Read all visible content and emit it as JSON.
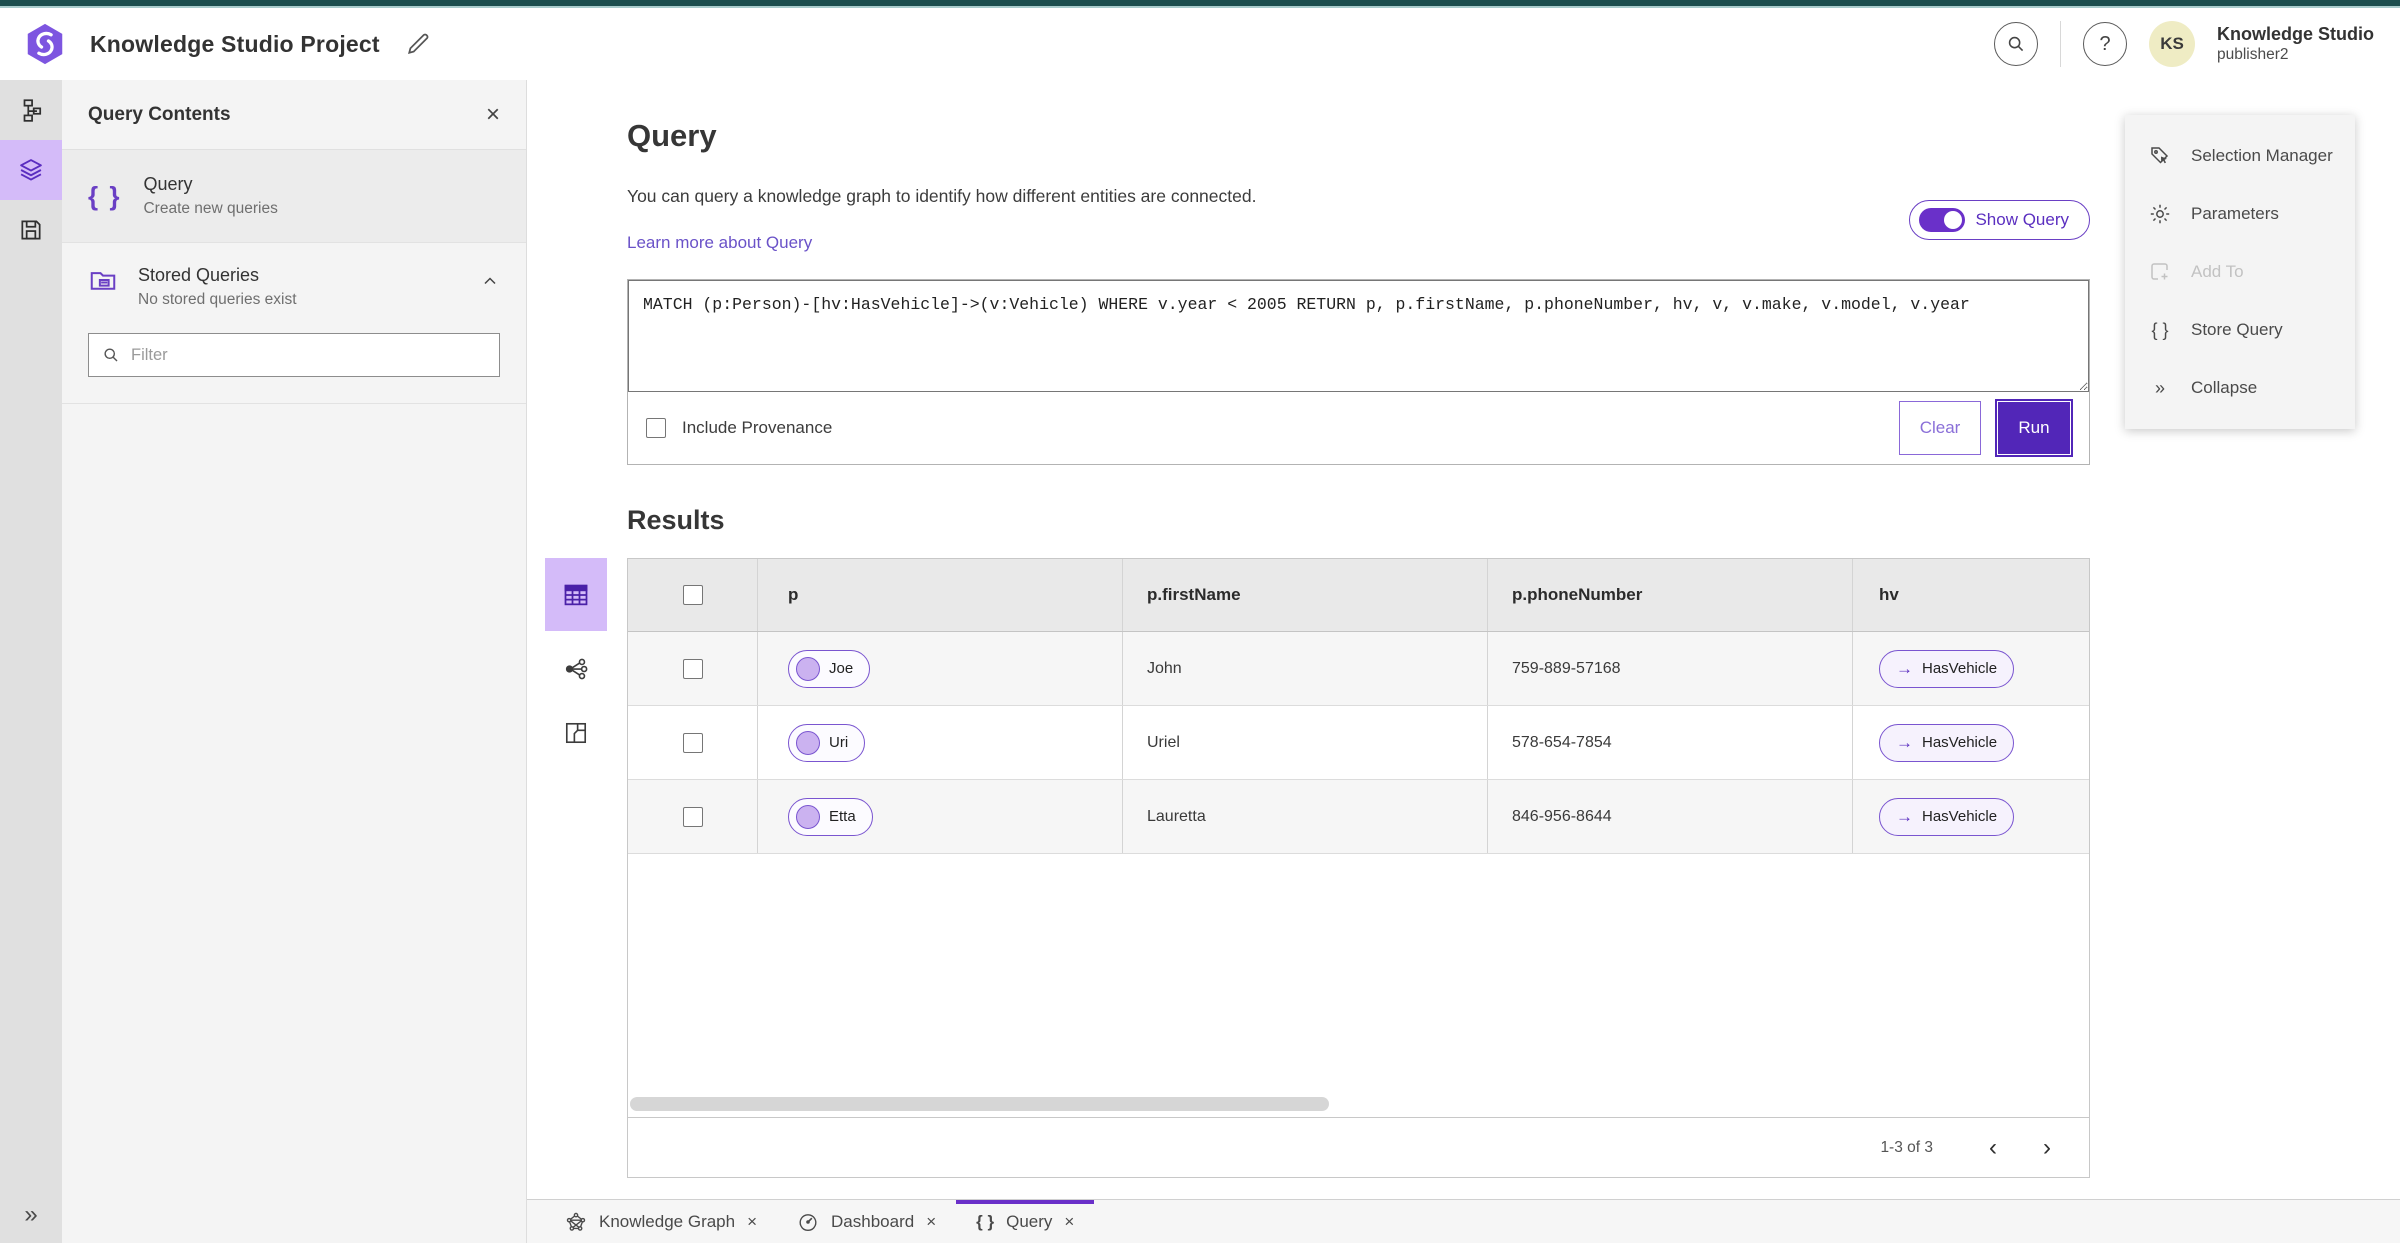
{
  "header": {
    "app_title": "Knowledge Studio Project",
    "user_name": "Knowledge Studio",
    "user_role": "publisher2",
    "avatar_initials": "KS"
  },
  "query_contents": {
    "title": "Query Contents",
    "query_item": {
      "label": "Query",
      "description": "Create new queries"
    },
    "stored_item": {
      "label": "Stored Queries",
      "description": "No stored queries exist"
    },
    "filter_placeholder": "Filter"
  },
  "query_panel": {
    "title": "Query",
    "description": "You can query a knowledge graph to identify how different entities are connected.",
    "link_label": "Learn more about Query",
    "show_query_label": "Show Query",
    "query_text": "MATCH (p:Person)-[hv:HasVehicle]->(v:Vehicle) WHERE v.year < 2005 RETURN p, p.firstName, p.phoneNumber, hv, v, v.make, v.model, v.year",
    "include_provenance_label": "Include Provenance",
    "clear_label": "Clear",
    "run_label": "Run"
  },
  "results": {
    "title": "Results",
    "columns": {
      "p": "p",
      "firstName": "p.firstName",
      "phoneNumber": "p.phoneNumber",
      "hv": "hv"
    },
    "rows": [
      {
        "p": "Joe",
        "firstName": "John",
        "phoneNumber": "759-889-57168",
        "hv": "HasVehicle"
      },
      {
        "p": "Uri",
        "firstName": "Uriel",
        "phoneNumber": "578-654-7854",
        "hv": "HasVehicle"
      },
      {
        "p": "Etta",
        "firstName": "Lauretta",
        "phoneNumber": "846-956-8644",
        "hv": "HasVehicle"
      }
    ],
    "pagination_label": "1-3 of 3"
  },
  "actions_panel": {
    "items": [
      {
        "label": "Selection Manager"
      },
      {
        "label": "Parameters"
      },
      {
        "label": "Add To"
      },
      {
        "label": "Store Query"
      },
      {
        "label": "Collapse"
      }
    ]
  },
  "bottom_tabs": [
    {
      "label": "Knowledge Graph"
    },
    {
      "label": "Dashboard"
    },
    {
      "label": "Query"
    }
  ],
  "icons": {
    "braces": "{ }",
    "close": "×",
    "help": "?",
    "collapse_chevrons": "»",
    "arrow_right": "→",
    "chevron_left": "‹",
    "chevron_right": "›"
  },
  "colors": {
    "primary_purple": "#5226b8",
    "accent_purple_light": "#d4bbf9",
    "teal_strip": "#1c4e4e",
    "link_purple": "#6a52c8"
  }
}
